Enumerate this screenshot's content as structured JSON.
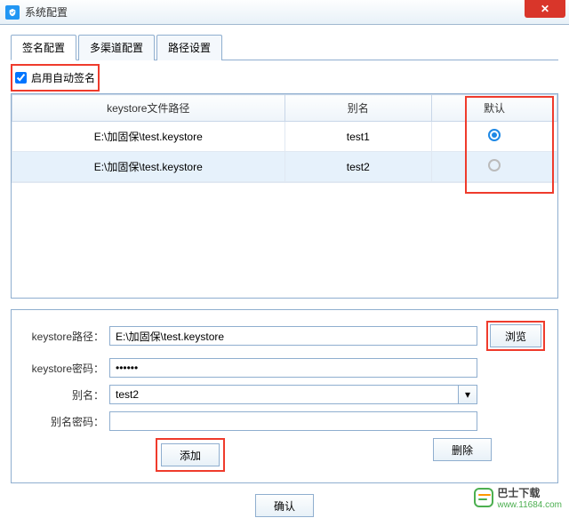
{
  "title": "系统配置",
  "tabs": [
    "签名配置",
    "多渠道配置",
    "路径设置"
  ],
  "auto_sign_label": "启用自动签名",
  "table": {
    "headers": [
      "keystore文件路径",
      "别名",
      "默认"
    ],
    "rows": [
      {
        "path": "E:\\加固保\\test.keystore",
        "alias": "test1",
        "default": true,
        "selected": false
      },
      {
        "path": "E:\\加固保\\test.keystore",
        "alias": "test2",
        "default": false,
        "selected": true
      }
    ]
  },
  "form": {
    "path_label": "keystore路径：",
    "path_value": "E:\\加固保\\test.keystore",
    "browse_label": "浏览",
    "pwd_label": "keystore密码：",
    "pwd_value": "••••••",
    "alias_label": "别名：",
    "alias_value": "test2",
    "alias_pwd_label": "别名密码：",
    "alias_pwd_value": "",
    "add_label": "添加",
    "delete_label": "删除"
  },
  "confirm_label": "确认",
  "watermark": {
    "text": "巴士下载",
    "url": "www.11684.com"
  }
}
